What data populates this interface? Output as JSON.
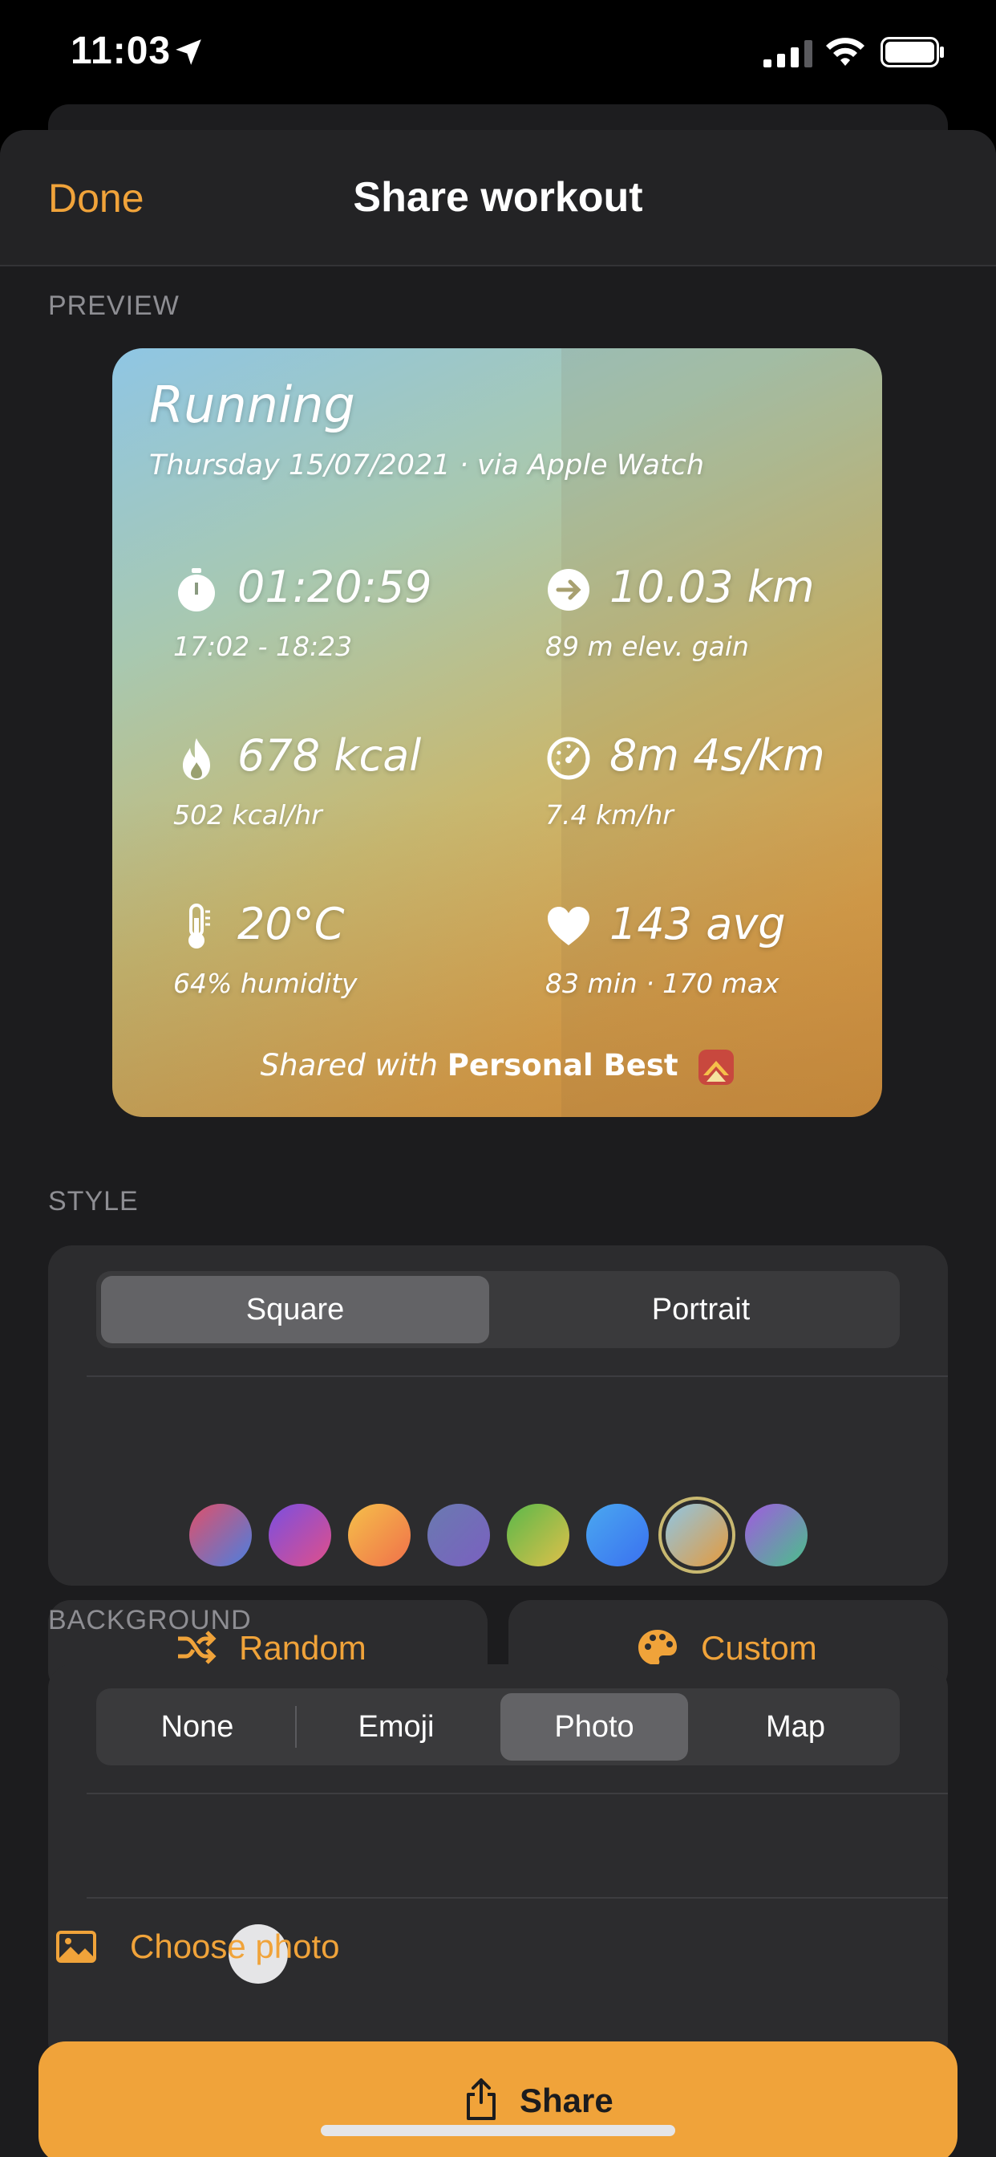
{
  "status_bar": {
    "time": "11:03"
  },
  "nav": {
    "done_label": "Done",
    "title": "Share workout"
  },
  "preview": {
    "section_label": "PREVIEW",
    "card": {
      "title": "Running",
      "date_line": "Thursday 15/07/2021 · via Apple Watch",
      "stats": [
        {
          "icon": "stopwatch-icon",
          "value": "01:20:59",
          "sub": "17:02 - 18:23"
        },
        {
          "icon": "arrow-right-circle-icon",
          "value": "10.03 km",
          "sub": "89 m elev. gain"
        },
        {
          "icon": "flame-icon",
          "value": "678 kcal",
          "sub": "502 kcal/hr"
        },
        {
          "icon": "speedometer-icon",
          "value": "8m 4s/km",
          "sub": "7.4 km/hr"
        },
        {
          "icon": "thermometer-icon",
          "value": "20°C",
          "sub": "64% humidity"
        },
        {
          "icon": "heart-icon",
          "value": "143 avg",
          "sub": "83 min · 170 max"
        }
      ],
      "footer_prefix": "Shared with",
      "footer_brand": "Personal Best"
    }
  },
  "style": {
    "section_label": "STYLE",
    "segments": [
      "Square",
      "Portrait"
    ],
    "selected_segment": "Square",
    "swatches": [
      {
        "name": "red-blue",
        "colors": [
          "#e0506a",
          "#4a7fe0"
        ]
      },
      {
        "name": "purple-pink",
        "colors": [
          "#7a4fe0",
          "#e04f8a"
        ]
      },
      {
        "name": "yellow-orange",
        "colors": [
          "#f5c04a",
          "#f0704a"
        ]
      },
      {
        "name": "slate-violet",
        "colors": [
          "#6a7ab0",
          "#7a60c0"
        ]
      },
      {
        "name": "green-yellow",
        "colors": [
          "#5ab84a",
          "#e0c04a"
        ]
      },
      {
        "name": "blue",
        "colors": [
          "#4aa8f0",
          "#3a70f0"
        ]
      },
      {
        "name": "sky-amber",
        "colors": [
          "#8fc6e4",
          "#e59a3c"
        ],
        "selected": true
      },
      {
        "name": "violet-green",
        "colors": [
          "#a05ae0",
          "#4ac08a"
        ]
      }
    ],
    "random_label": "Random",
    "custom_label": "Custom"
  },
  "background": {
    "section_label": "BACKGROUND",
    "segments": [
      "None",
      "Emoji",
      "Photo",
      "Map"
    ],
    "selected_segment": "Photo",
    "choose_photo_label": "Choose photo"
  },
  "share_label": "Share",
  "colors": {
    "accent": "#f0a33a",
    "sheet": "#1c1c1e",
    "card": "#2c2c2e"
  }
}
